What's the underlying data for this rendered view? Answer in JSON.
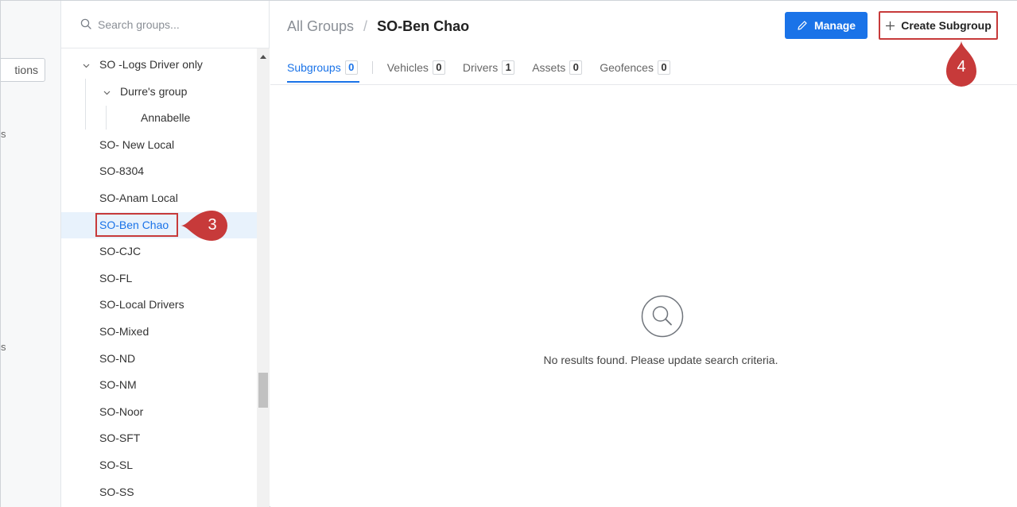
{
  "nav": {
    "actions_fragment": "tions",
    "frag_1": "s",
    "frag_2": "s"
  },
  "search": {
    "placeholder": "Search groups..."
  },
  "tree": {
    "items": [
      {
        "label": "SO -Logs Driver only",
        "expanded": true
      },
      {
        "label": "Durre's group",
        "expanded": true
      },
      {
        "label": "Annabelle"
      },
      {
        "label": "SO- New Local"
      },
      {
        "label": "SO-8304"
      },
      {
        "label": "SO-Anam Local"
      },
      {
        "label": "SO-Ben Chao",
        "selected": true
      },
      {
        "label": "SO-CJC"
      },
      {
        "label": "SO-FL"
      },
      {
        "label": "SO-Local Drivers"
      },
      {
        "label": "SO-Mixed"
      },
      {
        "label": "SO-ND"
      },
      {
        "label": "SO-NM"
      },
      {
        "label": "SO-Noor"
      },
      {
        "label": "SO-SFT"
      },
      {
        "label": "SO-SL"
      },
      {
        "label": "SO-SS"
      }
    ]
  },
  "breadcrumb": {
    "root": "All Groups",
    "separator": "/",
    "current": "SO-Ben Chao"
  },
  "toolbar": {
    "manage_label": "Manage",
    "create_label": "Create Subgroup"
  },
  "tabs": [
    {
      "label": "Subgroups",
      "count": "0",
      "active": true
    },
    {
      "label": "Vehicles",
      "count": "0"
    },
    {
      "label": "Drivers",
      "count": "1"
    },
    {
      "label": "Assets",
      "count": "0"
    },
    {
      "label": "Geofences",
      "count": "0"
    }
  ],
  "empty_state": {
    "message": "No results found. Please update search criteria."
  },
  "annotations": {
    "step_3": "3",
    "step_4": "4"
  },
  "colors": {
    "accent": "#1a73e8",
    "selected_bg": "#e8f2fc",
    "annotation_red": "#c73a3a"
  }
}
